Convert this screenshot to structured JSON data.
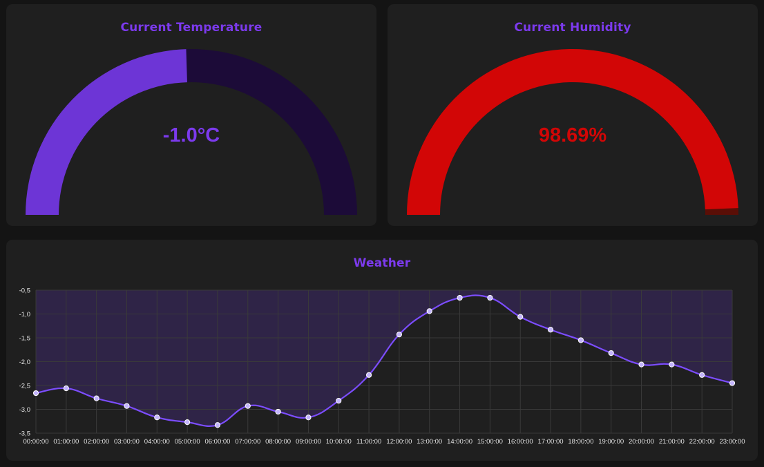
{
  "temperature_gauge": {
    "title": "Current Temperature",
    "value_text": "-1.0°C",
    "fill_fraction": 0.49,
    "colors": {
      "fill": "#6d35d6",
      "track": "#1c0b38",
      "text": "#7c3aed"
    }
  },
  "humidity_gauge": {
    "title": "Current Humidity",
    "value_text": "98.69%",
    "fill_fraction": 0.9869,
    "colors": {
      "fill": "#d20606",
      "track": "#5a0e06",
      "text": "#d20606"
    }
  },
  "weather_card": {
    "title": "Weather"
  },
  "chart_data": {
    "type": "line",
    "title": "Weather",
    "x": [
      "00:00:00",
      "01:00:00",
      "02:00:00",
      "03:00:00",
      "04:00:00",
      "05:00:00",
      "06:00:00",
      "07:00:00",
      "08:00:00",
      "09:00:00",
      "10:00:00",
      "11:00:00",
      "12:00:00",
      "13:00:00",
      "14:00:00",
      "15:00:00",
      "16:00:00",
      "17:00:00",
      "18:00:00",
      "19:00:00",
      "20:00:00",
      "21:00:00",
      "22:00:00",
      "23:00:00"
    ],
    "series": [
      {
        "values": [
          -2.66,
          -2.56,
          -2.77,
          -2.93,
          -3.17,
          -3.27,
          -3.33,
          -2.93,
          -3.05,
          -3.17,
          -2.82,
          -2.28,
          -1.43,
          -0.94,
          -0.66,
          -0.66,
          -1.06,
          -1.33,
          -1.55,
          -1.82,
          -2.06,
          -2.06,
          -2.28,
          -2.45
        ]
      }
    ],
    "ylim": [
      -3.5,
      -0.5
    ],
    "y_ticks": [
      "-0,5",
      "-1,0",
      "-1,5",
      "-2,0",
      "-2,5",
      "-3,0",
      "-3,5"
    ],
    "y_tick_values": [
      -0.5,
      -1.0,
      -1.5,
      -2.0,
      -2.5,
      -3.0,
      -3.5
    ],
    "grid": true,
    "fill": true,
    "colors": {
      "line": "#7c4dff",
      "area": "#2f2447",
      "grid": "#3a3a3a",
      "point_fill": "#c4b5fd"
    }
  }
}
